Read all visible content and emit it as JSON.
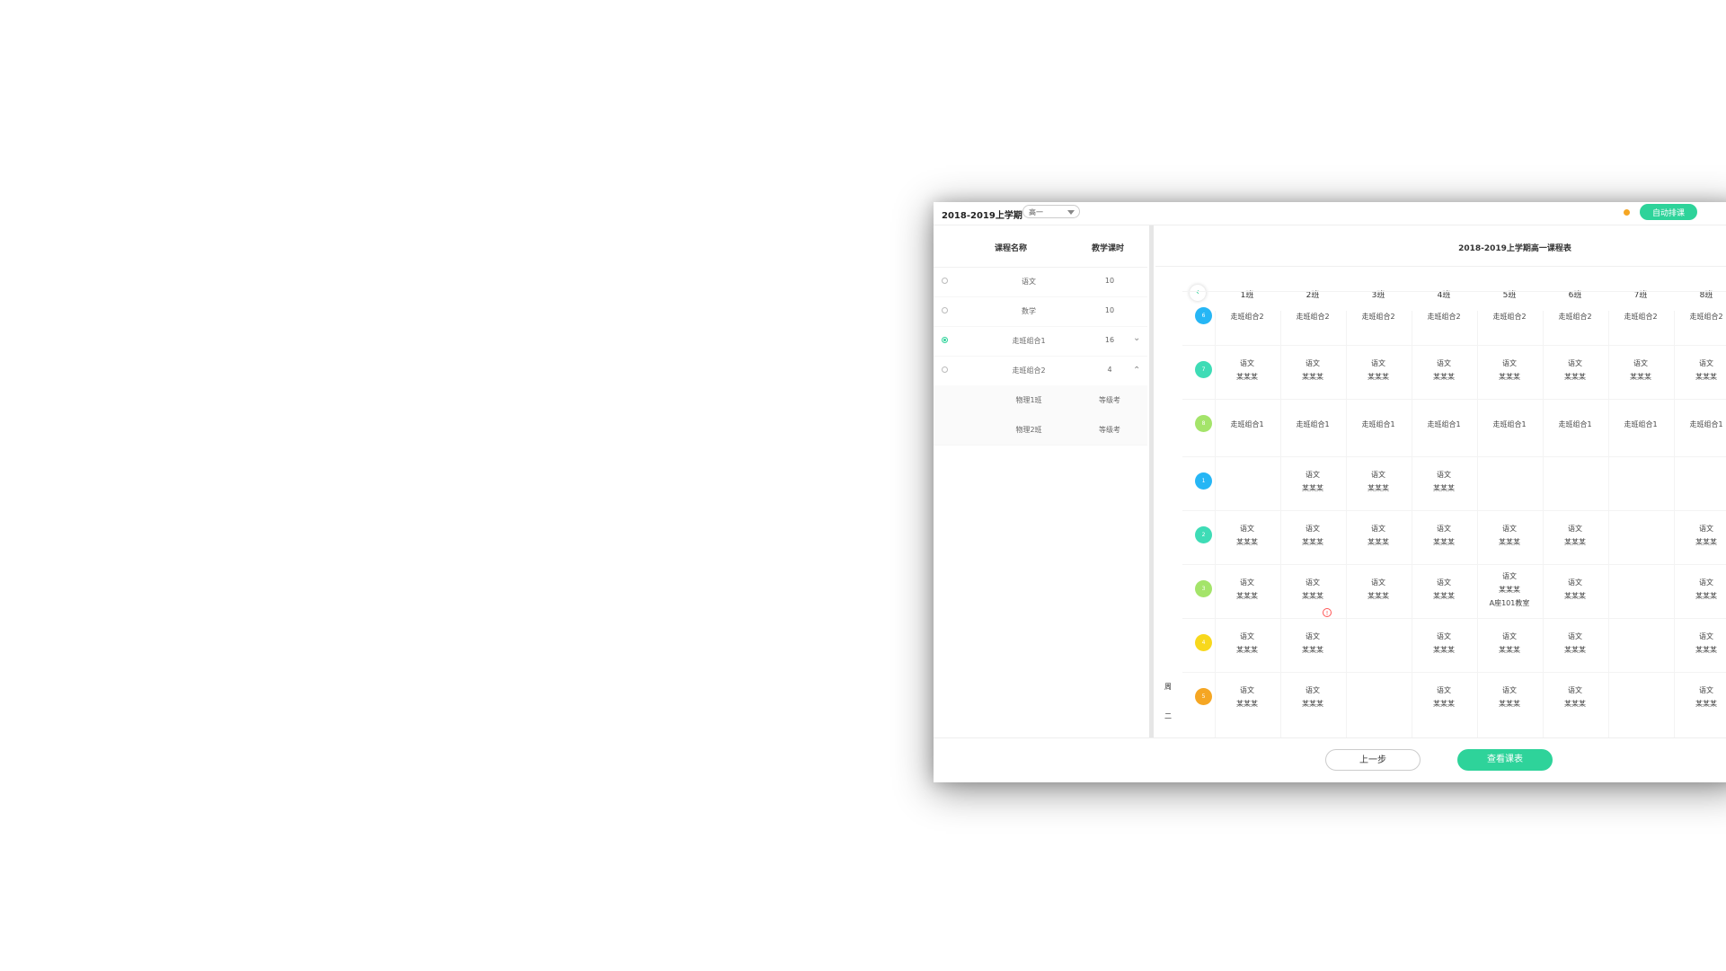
{
  "header": {
    "term_title": "2018-2019上学期",
    "grade_select": "高一",
    "auto_schedule_label": "自动排课"
  },
  "left_panel": {
    "col_course": "课程名称",
    "col_hours": "教学课时",
    "rows": [
      {
        "name": "语文",
        "hours": "10"
      },
      {
        "name": "数学",
        "hours": "10"
      },
      {
        "name": "走班组合1",
        "hours": "16"
      },
      {
        "name": "走班组合2",
        "hours": "4"
      }
    ],
    "sub_rows": [
      {
        "name": "物理1班",
        "type": "等级考"
      },
      {
        "name": "物理2班",
        "type": "等级考"
      }
    ]
  },
  "timetable": {
    "title": "2018-2019上学期高一课程表",
    "classes": [
      "1班",
      "2班",
      "3班",
      "4班",
      "5班",
      "6班",
      "7班",
      "8班"
    ],
    "week_label_1": "周",
    "week_label_2": "二",
    "periods": [
      "6",
      "7",
      "8",
      "1",
      "2",
      "3",
      "4",
      "5"
    ],
    "period_colors": [
      "#26b6f5",
      "#3edcb6",
      "#a4e46a",
      "#26b6f5",
      "#3edcb6",
      "#a4e46a",
      "#f8d81c",
      "#f5a623"
    ],
    "rows": [
      [
        "走班组合2",
        "走班组合2",
        "走班组合2",
        "走班组合2",
        "走班组合2",
        "走班组合2",
        "走班组合2",
        "走班组合2"
      ],
      [
        "语文|某某某",
        "语文|某某某",
        "语文|某某某",
        "语文|某某某",
        "语文|某某某",
        "语文|某某某",
        "语文|某某某",
        "语文|某某某"
      ],
      [
        "走班组合1",
        "走班组合1",
        "走班组合1",
        "走班组合1",
        "走班组合1",
        "走班组合1",
        "走班组合1",
        "走班组合1"
      ],
      [
        "",
        "语文|某某某",
        "语文|某某某",
        "语文|某某某",
        "",
        "",
        "",
        ""
      ],
      [
        "语文|某某某",
        "语文|某某某",
        "语文|某某某",
        "语文|某某某",
        "语文|某某某",
        "语文|某某某",
        "",
        "语文|某某某"
      ],
      [
        "语文|某某某",
        "语文|某某某",
        "语文|某某某",
        "语文|某某某",
        "语文|某某某|A座101教室",
        "语文|某某某",
        "",
        "语文|某某某"
      ],
      [
        "语文|某某某",
        "语文|某某某",
        "",
        "语文|某某某",
        "语文|某某某",
        "语文|某某某",
        "",
        "语文|某某某"
      ],
      [
        "语文|某某某",
        "语文|某某某",
        "",
        "语文|某某某",
        "语文|某某某",
        "语文|某某某",
        "",
        "语文|某某某"
      ]
    ]
  },
  "footer": {
    "prev_label": "上一步",
    "view_label": "查看课表"
  }
}
